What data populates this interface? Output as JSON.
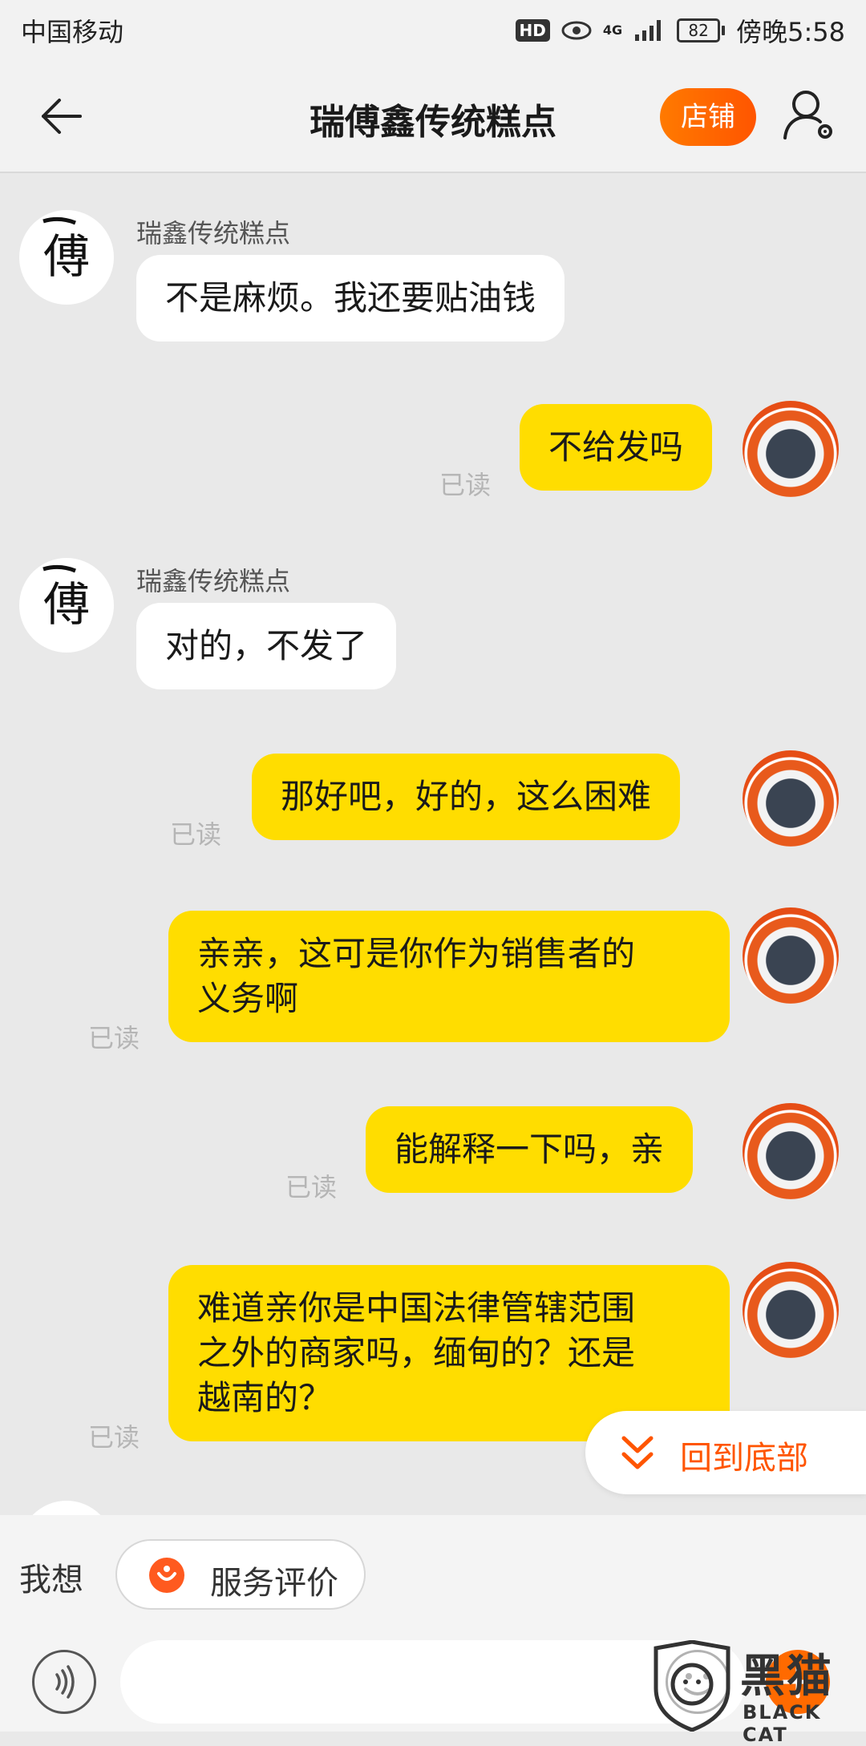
{
  "status_bar": {
    "carrier": "中国移动",
    "hd": "HD",
    "network": "4G",
    "battery": "82",
    "time": "傍晚5:58"
  },
  "nav": {
    "title": "瑞傅鑫传统糕点",
    "shop_button": "店铺"
  },
  "messages": [
    {
      "direction": "in",
      "sender": "瑞鑫传统糕点",
      "text": "不是麻烦。我还要贴油钱"
    },
    {
      "direction": "out",
      "text": "不给发吗",
      "status": "已读"
    },
    {
      "direction": "in",
      "sender": "瑞鑫传统糕点",
      "text": "对的，不发了"
    },
    {
      "direction": "out",
      "text": "那好吧，好的，这么困难",
      "status": "已读"
    },
    {
      "direction": "out",
      "lines": [
        "亲亲，这可是你作为销售者的",
        "义务啊"
      ],
      "status": "已读"
    },
    {
      "direction": "out",
      "text": "能解释一下吗，亲",
      "status": "已读"
    },
    {
      "direction": "out",
      "lines": [
        "难道亲你是中国法律管辖范围",
        "之外的商家吗，缅甸的？还是",
        "越南的？"
      ],
      "status": "已读"
    }
  ],
  "back_to_bottom": "回到底部",
  "quick_bar": {
    "label": "我想",
    "chip": "服务评价"
  },
  "input": {
    "placeholder": ""
  },
  "watermark": {
    "text": "黑猫",
    "sub": "BLACK CAT"
  },
  "icons": {
    "back": "arrow-left-icon",
    "profile": "user-settings-icon",
    "voice": "voice-icon",
    "emoji": "emoji-icon",
    "plus": "plus-icon",
    "chevron": "double-chevron-down-icon"
  },
  "colors": {
    "accent": "#ff5500",
    "outgoing_bubble": "#ffdd00",
    "incoming_bubble": "#ffffff",
    "chat_bg": "#e9e9e9"
  }
}
